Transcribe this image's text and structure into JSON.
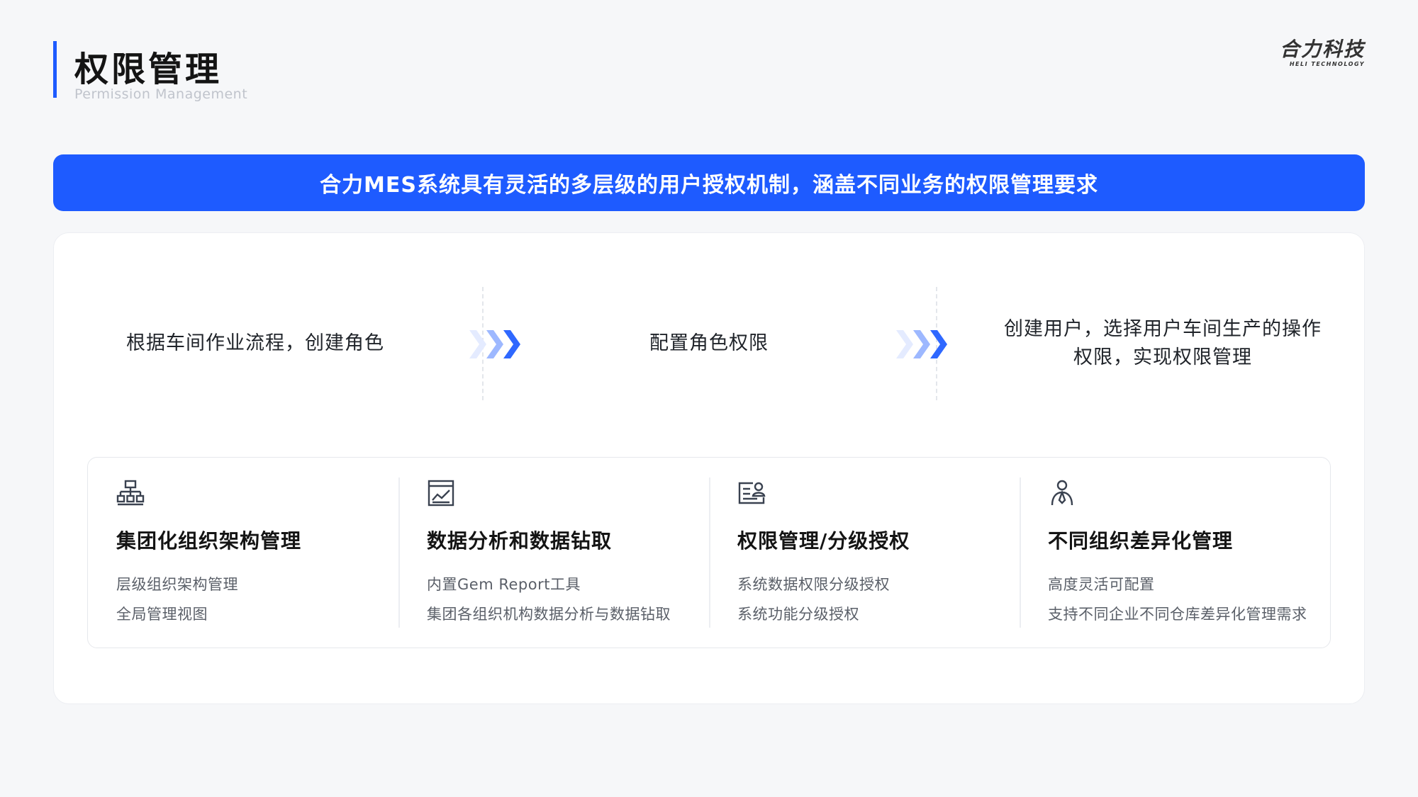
{
  "header": {
    "title": "权限管理",
    "subtitle": "Permission Management",
    "logo_cn": "合力科技",
    "logo_en": "HELI TECHNOLOGY"
  },
  "banner": {
    "text": "合力MES系统具有灵活的多层级的用户授权机制，涵盖不同业务的权限管理要求"
  },
  "steps": [
    {
      "text": "根据车间作业流程，创建角色"
    },
    {
      "text": "配置角色权限"
    },
    {
      "line1": "创建用户，选择用户车间生产的操作",
      "line2": "权限，实现权限管理"
    }
  ],
  "features": [
    {
      "icon": "org-chart-icon",
      "title": "集团化组织架构管理",
      "lines": [
        "层级组织架构管理",
        "全局管理视图"
      ]
    },
    {
      "icon": "data-chart-icon",
      "title": "数据分析和数据钻取",
      "lines": [
        "内置Gem Report工具",
        "集团各组织机构数据分析与数据钻取"
      ]
    },
    {
      "icon": "user-permission-icon",
      "title": "权限管理/分级授权",
      "lines": [
        "系统数据权限分级授权",
        "系统功能分级授权"
      ]
    },
    {
      "icon": "person-icon",
      "title": "不同组织差异化管理",
      "lines": [
        "高度灵活可配置",
        "支持不同企业不同仓库差异化管理需求"
      ]
    }
  ],
  "colors": {
    "accent": "#1e5bff",
    "background": "#f6f7f9",
    "icon": "#3a4250"
  }
}
